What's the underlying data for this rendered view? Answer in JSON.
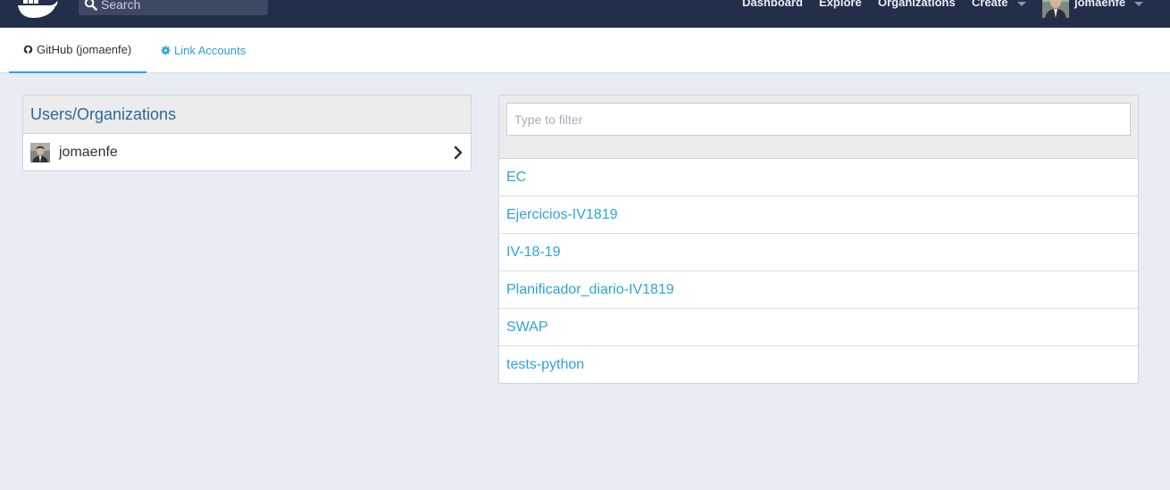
{
  "nav": {
    "search_placeholder": "Search",
    "links": [
      "Dashboard",
      "Explore",
      "Organizations",
      "Create"
    ],
    "username": "jomaenfe"
  },
  "tabs": {
    "github": "GitHub (jomaenfe)",
    "link_accounts": "Link Accounts"
  },
  "users_panel": {
    "title": "Users/Organizations",
    "user": "jomaenfe"
  },
  "repos_panel": {
    "filter_placeholder": "Type to filter",
    "repos": [
      "EC",
      "Ejercicios-IV1819",
      "IV-18-19",
      "Planificador_diario-IV1819",
      "SWAP",
      "tests-python"
    ]
  },
  "colors": {
    "nav_bg": "#232e4a",
    "accent": "#1aaaf8",
    "link": "#2ea3d9",
    "page_bg": "#e8ecf4"
  }
}
